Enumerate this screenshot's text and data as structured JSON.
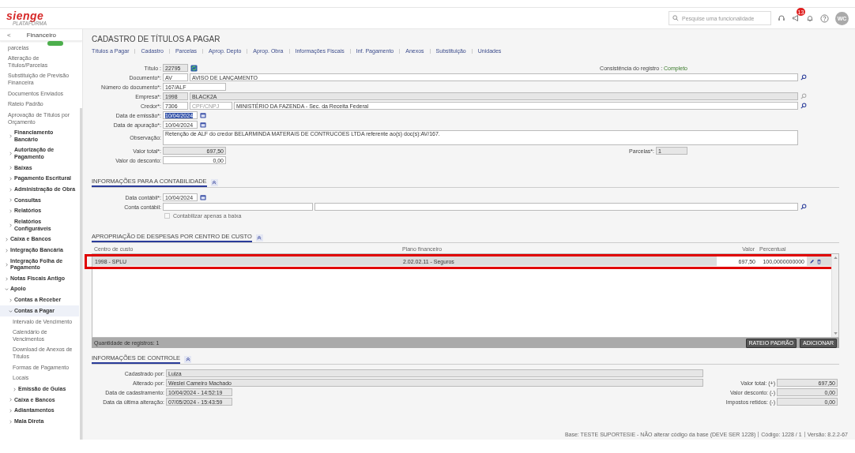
{
  "header": {
    "logo": "sienge",
    "logo_sub": "PLATAFORMA",
    "search": {
      "placeholder": "Pesquise uma funcionalidade"
    },
    "notification_count": "13",
    "avatar": "WC"
  },
  "sidebar": {
    "back": "<",
    "title": "Financeiro",
    "continued_items": [
      {
        "label": "parcelas",
        "kind": "leaf",
        "badge": true,
        "selected": false
      },
      {
        "label": "Alteração de Títulos/Parcelas",
        "kind": "leaf",
        "selected": false
      },
      {
        "label": "Substituição de Previsão Financeira",
        "kind": "leaf",
        "selected": false
      },
      {
        "label": "Documentos Enviados",
        "kind": "leaf",
        "selected": false
      },
      {
        "label": "Rateio Padrão",
        "kind": "leaf",
        "selected": false
      },
      {
        "label": "Aprovação de Títulos por Orçamento",
        "kind": "leaf",
        "selected": false
      },
      {
        "label": "Financiamento Bancário",
        "kind": "group",
        "expanded": false,
        "selected": false
      },
      {
        "label": "Autorização de Pagamento",
        "kind": "group",
        "expanded": false,
        "selected": false
      },
      {
        "label": "Baixas",
        "kind": "group",
        "expanded": false,
        "selected": false
      },
      {
        "label": "Pagamento Escritural",
        "kind": "group",
        "expanded": false,
        "selected": false
      },
      {
        "label": "Administração de Obra",
        "kind": "group",
        "expanded": false,
        "selected": false
      },
      {
        "label": "Consultas",
        "kind": "group",
        "expanded": false,
        "selected": false
      },
      {
        "label": "Relatórios",
        "kind": "group",
        "expanded": false,
        "selected": false
      },
      {
        "label": "Relatórios Configuráveis",
        "kind": "group",
        "expanded": false,
        "selected": false
      }
    ],
    "items": [
      {
        "label": "Caixa e Bancos",
        "kind": "group",
        "expanded": false,
        "selected": false
      },
      {
        "label": "Integração Bancária",
        "kind": "group",
        "expanded": false,
        "selected": false
      },
      {
        "label": "Integração Folha de Pagamento",
        "kind": "group",
        "expanded": false,
        "selected": false
      },
      {
        "label": "Notas Fiscais Antigo",
        "kind": "group",
        "expanded": false,
        "selected": false
      },
      {
        "label": "Apoio",
        "kind": "group",
        "expanded": true,
        "selected": false,
        "children": [
          {
            "label": "Contas a Receber",
            "kind": "group",
            "expanded": false,
            "selected": false
          },
          {
            "label": "Contas a Pagar",
            "kind": "group",
            "expanded": true,
            "selected": true,
            "children": [
              {
                "label": "Intervalo de Vencimento",
                "kind": "leaf",
                "selected": false
              },
              {
                "label": "Calendário de Vencimentos",
                "kind": "leaf",
                "selected": false
              },
              {
                "label": "Download de Anexos de Títulos",
                "kind": "leaf",
                "selected": false
              },
              {
                "label": "Formas de Pagamento",
                "kind": "leaf",
                "selected": false
              },
              {
                "label": "Locais",
                "kind": "leaf",
                "selected": false
              },
              {
                "label": "Emissão de Guias",
                "kind": "group",
                "expanded": false,
                "selected": false
              }
            ]
          },
          {
            "label": "Caixa e Bancos",
            "kind": "group",
            "expanded": false,
            "selected": false
          },
          {
            "label": "Adiantamentos",
            "kind": "group",
            "expanded": false,
            "selected": false
          },
          {
            "label": "Mala Direta",
            "kind": "group",
            "expanded": false,
            "selected": false
          }
        ]
      }
    ]
  },
  "form": {
    "title": "CADASTRO DE TÍTULOS A PAGAR",
    "nav_links": [
      "Títulos a Pagar",
      "Cadastro",
      "Parcelas",
      "Aprop. Depto",
      "Aprop. Obra",
      "Informações Fiscais",
      "Inf. Pagamento",
      "Anexos",
      "Substituição",
      "Unidades"
    ],
    "fields": [
      {
        "label": "Título :",
        "parts": [
          {
            "kind": "code",
            "value": "22795",
            "disabled": true,
            "highlighted": false
          }
        ],
        "action": {
          "kind": "refresh",
          "disabled": false
        },
        "aside": {
          "kind": "status",
          "label": "Consistência do registro :",
          "value": "Completo"
        }
      },
      {
        "label": "Documento*:",
        "parts": [
          {
            "kind": "code",
            "value": "AV",
            "disabled": false,
            "highlighted": false
          },
          {
            "kind": "name",
            "value": "AVISO DE LANÇAMENTO",
            "disabled": false,
            "highlighted": false
          }
        ],
        "action": {
          "kind": "search",
          "disabled": false
        }
      },
      {
        "label": "Número do documento*:",
        "parts": [
          {
            "kind": "medium",
            "value": "167/ALF",
            "disabled": false,
            "highlighted": false
          }
        ]
      },
      {
        "label": "Empresa*:",
        "parts": [
          {
            "kind": "code",
            "value": "1998",
            "disabled": true,
            "highlighted": false
          },
          {
            "kind": "name",
            "value": "BLACK2A",
            "disabled": true,
            "highlighted": false
          }
        ],
        "action": {
          "kind": "search",
          "disabled": true
        }
      },
      {
        "label": "Credor*:",
        "parts": [
          {
            "kind": "code",
            "value": "7306",
            "disabled": false,
            "highlighted": false
          },
          {
            "kind": "doc",
            "placeholder": "CPF/CNPJ",
            "disabled": false
          },
          {
            "kind": "name",
            "value": "MINISTÉRIO DA FAZENDA - Sec. da Receita Federal",
            "disabled": false,
            "highlighted": false
          }
        ],
        "action": {
          "kind": "search",
          "disabled": false
        }
      },
      {
        "label": "Data de emissão*:",
        "parts": [
          {
            "kind": "date",
            "value": "10/04/2024",
            "disabled": false,
            "highlighted": true
          }
        ],
        "action": {
          "kind": "calendar",
          "disabled": false
        }
      },
      {
        "label": "Data de apuração*:",
        "parts": [
          {
            "kind": "date",
            "value": "10/04/2024",
            "disabled": false,
            "highlighted": false
          }
        ],
        "action": {
          "kind": "calendar",
          "disabled": false
        }
      },
      {
        "label": "Observação:",
        "parts": [
          {
            "kind": "textarea",
            "value": "Retenção de ALF do credor BELARMINDA MATERAIS DE CONTRUCOES LTDA referente ao(s) doc(s):AV/167.",
            "disabled": false,
            "highlighted": false
          }
        ]
      },
      {
        "label": "Valor total*:",
        "parts": [
          {
            "kind": "amount",
            "value": "697,50",
            "disabled": true,
            "highlighted": false
          }
        ],
        "aside": {
          "kind": "field",
          "label": "Parcelas*:",
          "value": "1"
        }
      },
      {
        "label": "Valor do desconto:",
        "parts": [
          {
            "kind": "amount",
            "value": "0,00",
            "disabled": false,
            "highlighted": false
          }
        ]
      }
    ]
  },
  "accounting": {
    "title": "INFORMAÇÕES PARA A CONTABILIDADE",
    "fields": [
      {
        "label": "Data contábil*:",
        "parts": [
          {
            "kind": "date",
            "value": "10/04/2024",
            "disabled": false,
            "highlighted": false
          }
        ],
        "action": {
          "kind": "calendar",
          "disabled": false
        }
      },
      {
        "label": "Conta contábil:",
        "parts": [
          {
            "kind": "account",
            "disabled": false
          },
          {
            "kind": "name",
            "disabled": false
          }
        ],
        "action": {
          "kind": "search",
          "disabled": false
        }
      }
    ],
    "checkbox": {
      "label": "Contabilizar apenas a baixa",
      "checked": false
    }
  },
  "allocation": {
    "title": "APROPRIAÇÃO DE DESPESAS POR CENTRO DE CUSTO",
    "columns": [
      "Centro de custo",
      "Plano financeiro",
      "Valor",
      "Percentual"
    ],
    "rows": [
      {
        "cost_center": "1998 - SPLU",
        "plan": "2.02.02.11 - Seguros",
        "value": "697,50",
        "percent": "100,0000000000",
        "highlighted": true
      }
    ],
    "count_label": "Quantidade de registros: 1",
    "buttons": [
      "RATEIO PADRÃO",
      "ADICIONAR"
    ]
  },
  "control": {
    "title": "INFORMAÇÕES DE CONTROLE",
    "rows": [
      {
        "label": "Cadastrado por:",
        "kind": "long",
        "value": "Luiza"
      },
      {
        "label": "Alterado por:",
        "kind": "long",
        "value": "Weslei Cameiro Machado",
        "aside": {
          "label": "Valor total: (+)",
          "value": "697,50"
        }
      },
      {
        "label": "Data de cadastramento:",
        "kind": "date",
        "value": "10/04/2024 - 14:52:19",
        "aside": {
          "label": "Valor desconto: (-)",
          "value": "0,00"
        }
      },
      {
        "label": "Data da última alteração:",
        "kind": "date",
        "value": "07/05/2024 - 15:43:59",
        "aside": {
          "label": "Impostos retidos: (-)",
          "value": "0,00"
        }
      }
    ]
  },
  "status_bar": [
    "Base: TESTE SUPORTESIE - NÃO alterar código da base (DEVE SER 1228)",
    "Código: 1228 / 1",
    "Versão: 8.2.2-67"
  ]
}
